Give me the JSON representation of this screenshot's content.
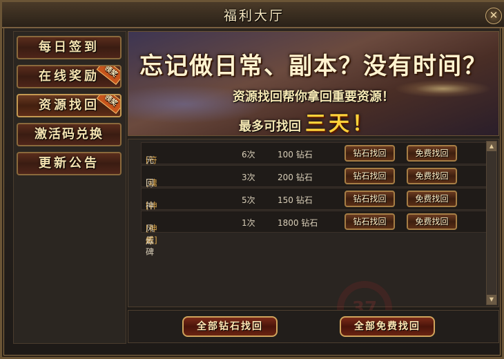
{
  "window": {
    "title": "福利大厅",
    "close_icon": "close-icon"
  },
  "sidebar": {
    "items": [
      {
        "label": "每日签到",
        "badge": ""
      },
      {
        "label": "在线奖励",
        "badge": "领奖"
      },
      {
        "label": "资源找回",
        "badge": "领奖"
      },
      {
        "label": "激活码兑换",
        "badge": ""
      },
      {
        "label": "更新公告",
        "badge": ""
      }
    ]
  },
  "banner": {
    "headline": "忘记做日常、副本？没有时间？",
    "line2": "资源找回帮你拿回重要资源！",
    "line3_prefix": "最多可找回",
    "line3_highlight": "三天！"
  },
  "rows": [
    {
      "tag": "[符文]",
      "name": "元宝符文",
      "count": "6次",
      "cost": "100 钻石",
      "btn_diamond": "钻石找回",
      "btn_free": "免费找回"
    },
    {
      "tag": "[魂珠]",
      "name": "回收任务",
      "count": "3次",
      "cost": "200 钻石",
      "btn_diamond": "钻石找回",
      "btn_free": "免费找回"
    },
    {
      "tag": "[神威]",
      "name": "神威试炼",
      "count": "5次",
      "cost": "150 钻石",
      "btn_diamond": "钻石找回",
      "btn_free": "免费找回"
    },
    {
      "tag": "[神威]",
      "name": "风云碑",
      "count": "1次",
      "cost": "1800 钻石",
      "btn_diamond": "钻石找回",
      "btn_free": "免费找回"
    }
  ],
  "footer": {
    "all_diamond": "全部钻石找回",
    "all_free": "全部免费找回"
  },
  "colors": {
    "frame_gold": "#8a6e45",
    "button_red": "#5a2d1c",
    "highlight_yellow": "#ffd23a"
  }
}
